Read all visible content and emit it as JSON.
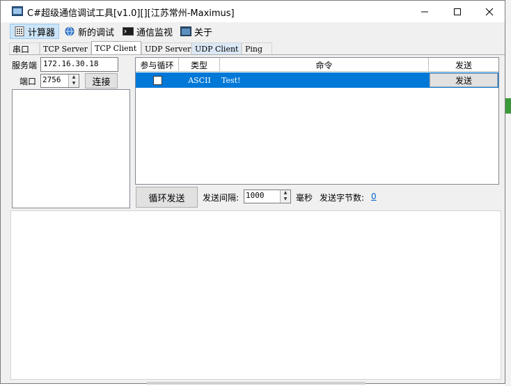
{
  "window": {
    "title": "C#超级通信调试工具[v1.0][][江苏常州-Maximus]"
  },
  "menu": {
    "items": [
      {
        "label": "计算器",
        "icon": "calculator-icon"
      },
      {
        "label": "新的调试",
        "icon": "globe-icon"
      },
      {
        "label": "通信监视",
        "icon": "terminal-icon"
      },
      {
        "label": "关于",
        "icon": "info-window-icon"
      }
    ]
  },
  "tabs": [
    {
      "label": "串口"
    },
    {
      "label": "TCP Server"
    },
    {
      "label": "TCP Client"
    },
    {
      "label": "UDP Server"
    },
    {
      "label": "UDP Client"
    },
    {
      "label": "Ping"
    }
  ],
  "connection": {
    "server_label": "服务端",
    "server_value": "172.16.30.18",
    "port_label": "端口",
    "port_value": "2756",
    "connect_button": "连接"
  },
  "grid": {
    "headers": [
      "参与循环",
      "类型",
      "命令",
      "发送"
    ],
    "rows": [
      {
        "loop": false,
        "type": "ASCII",
        "command": "Test!",
        "send_label": "发送"
      }
    ]
  },
  "loop": {
    "button": "循环发送",
    "interval_label": "发送间隔:",
    "interval_value": "1000",
    "unit": "毫秒",
    "bytes_label": "发送字节数:",
    "bytes_value": "0"
  },
  "colors": {
    "selection": "#0078d7",
    "link": "#0066cc"
  }
}
